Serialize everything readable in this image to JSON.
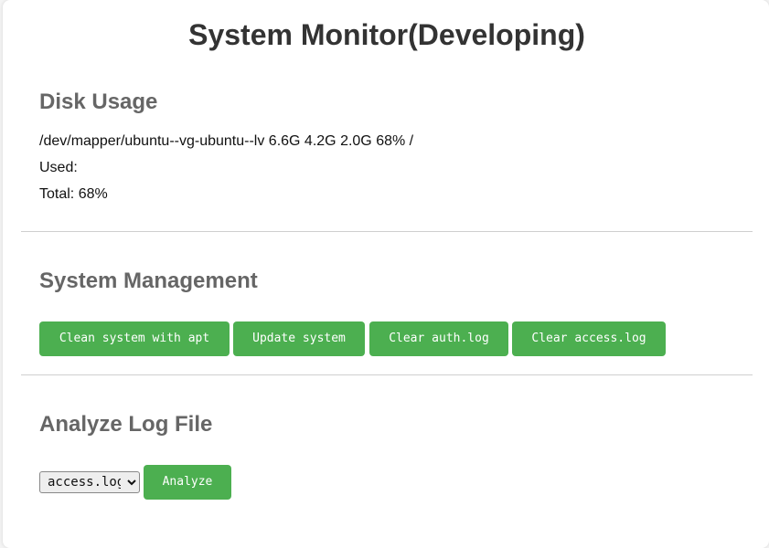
{
  "header": {
    "title": "System Monitor(Developing)"
  },
  "disk_usage": {
    "heading": "Disk Usage",
    "device_line": "/dev/mapper/ubuntu--vg-ubuntu--lv 6.6G 4.2G 2.0G 68% /",
    "used_label": "Used:",
    "total_label": "Total: 68%"
  },
  "system_management": {
    "heading": "System Management",
    "buttons": [
      {
        "label": "Clean system with apt"
      },
      {
        "label": "Update system"
      },
      {
        "label": "Clear auth.log"
      },
      {
        "label": "Clear access.log"
      }
    ]
  },
  "analyze_log": {
    "heading": "Analyze Log File",
    "select_value": "access.log",
    "analyze_label": "Analyze"
  },
  "colors": {
    "button_green": "#4caf50",
    "heading_gray": "#666666",
    "title_dark": "#333333"
  }
}
